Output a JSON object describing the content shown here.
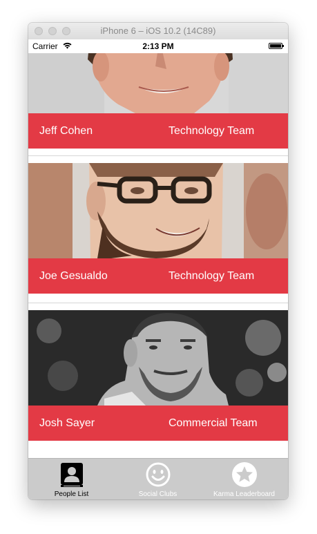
{
  "window": {
    "title": "iPhone 6 – iOS 10.2 (14C89)"
  },
  "status_bar": {
    "carrier": "Carrier",
    "time": "2:13 PM"
  },
  "people": [
    {
      "name": "Jeff Cohen",
      "team": "Technology Team"
    },
    {
      "name": "Joe Gesualdo",
      "team": "Technology Team"
    },
    {
      "name": "Josh Sayer",
      "team": "Commercial Team"
    }
  ],
  "tab_bar": {
    "tabs": [
      {
        "label": "People List",
        "icon": "contact-card-icon",
        "selected": true
      },
      {
        "label": "Social Clubs",
        "icon": "smiley-face-icon",
        "selected": false
      },
      {
        "label": "Karma Leaderboard",
        "icon": "star-icon",
        "selected": false
      }
    ]
  },
  "colors": {
    "name_bar": "#e33a45",
    "tab_bar": "#cbcbcb",
    "tab_active": "#000000",
    "tab_inactive": "#ffffff"
  }
}
